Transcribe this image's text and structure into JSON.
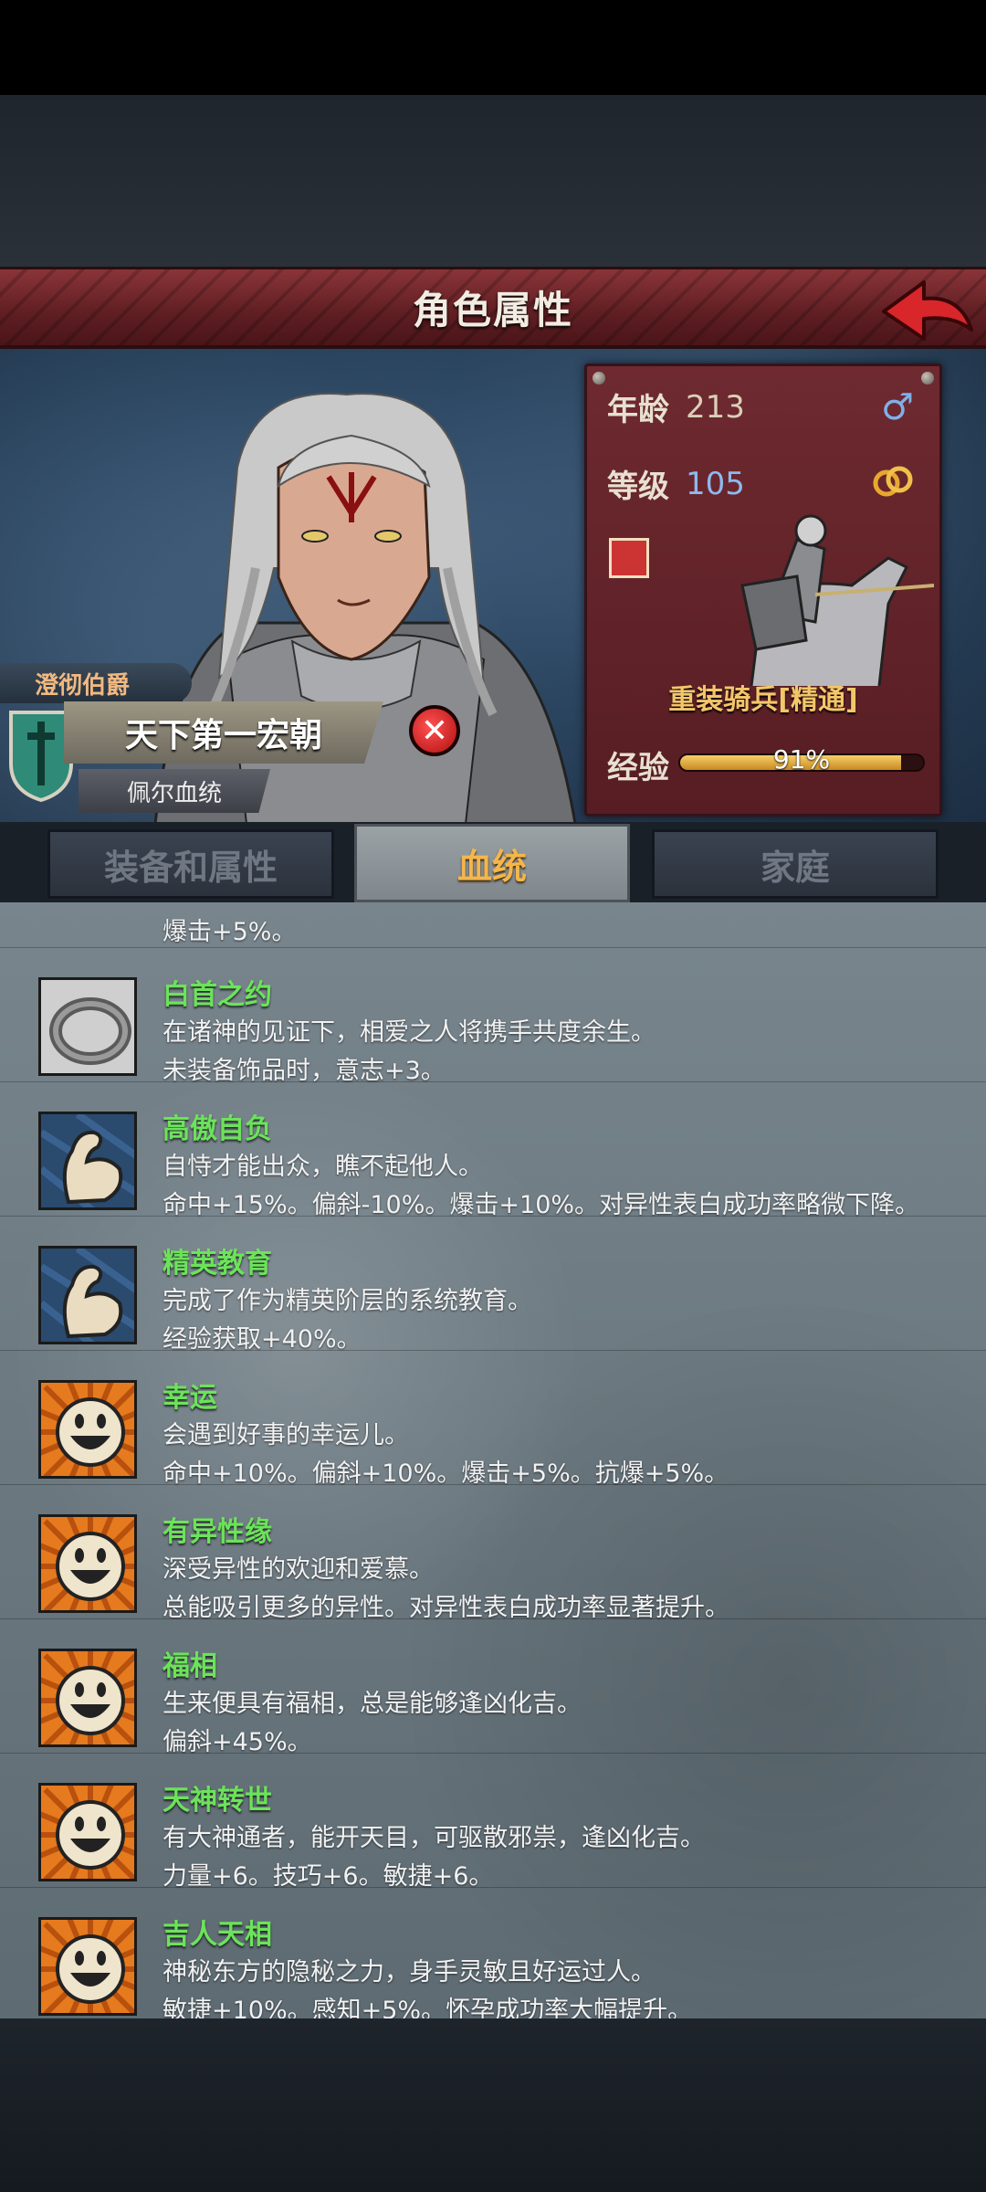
{
  "header": {
    "title": "角色属性"
  },
  "character": {
    "title_badge": "澄彻伯爵",
    "name": "天下第一宏朝",
    "bloodline": "佩尔血统",
    "gender_symbol": "♂"
  },
  "stats": {
    "age_label": "年龄",
    "age_value": "213",
    "level_label": "等级",
    "level_value": "105",
    "unit_name": "重装骑兵[精通]",
    "exp_label": "经验",
    "exp_text": "91%",
    "exp_fraction": 0.91
  },
  "tabs": [
    {
      "label": "装备和属性",
      "active": false
    },
    {
      "label": "血统",
      "active": true
    },
    {
      "label": "家庭",
      "active": false
    }
  ],
  "list": {
    "partial_top_effect": "爆击+5%。",
    "traits": [
      {
        "name": "白首之约",
        "desc": "在诸神的见证下，相爱之人将携手共度余生。",
        "effect": "未装备饰品时，意志+3。",
        "icon": "ring-icon"
      },
      {
        "name": "高傲自负",
        "desc": "自恃才能出众，瞧不起他人。",
        "effect": "命中+15%。偏斜-10%。爆击+10%。对异性表白成功率略微下降。",
        "icon": "arm-icon"
      },
      {
        "name": "精英教育",
        "desc": "完成了作为精英阶层的系统教育。",
        "effect": "经验获取+40%。",
        "icon": "arm-icon"
      },
      {
        "name": "幸运",
        "desc": "会遇到好事的幸运儿。",
        "effect": "命中+10%。偏斜+10%。爆击+5%。抗爆+5%。",
        "icon": "smiley-icon"
      },
      {
        "name": "有异性缘",
        "desc": "深受异性的欢迎和爱慕。",
        "effect": "总能吸引更多的异性。对异性表白成功率显著提升。",
        "icon": "smiley-icon"
      },
      {
        "name": "福相",
        "desc": "生来便具有福相，总是能够逢凶化吉。",
        "effect": "偏斜+45%。",
        "icon": "smiley-icon"
      },
      {
        "name": "天神转世",
        "desc": "有大神通者，能开天目，可驱散邪祟，逢凶化吉。",
        "effect": "力量+6。技巧+6。敏捷+6。",
        "icon": "smiley-icon"
      },
      {
        "name": "吉人天相",
        "desc": "神秘东方的隐秘之力，身手灵敏且好运过人。",
        "effect": "敏捷+10%。感知+5%。怀孕成功率大幅提升。",
        "icon": "smiley-icon"
      }
    ]
  }
}
